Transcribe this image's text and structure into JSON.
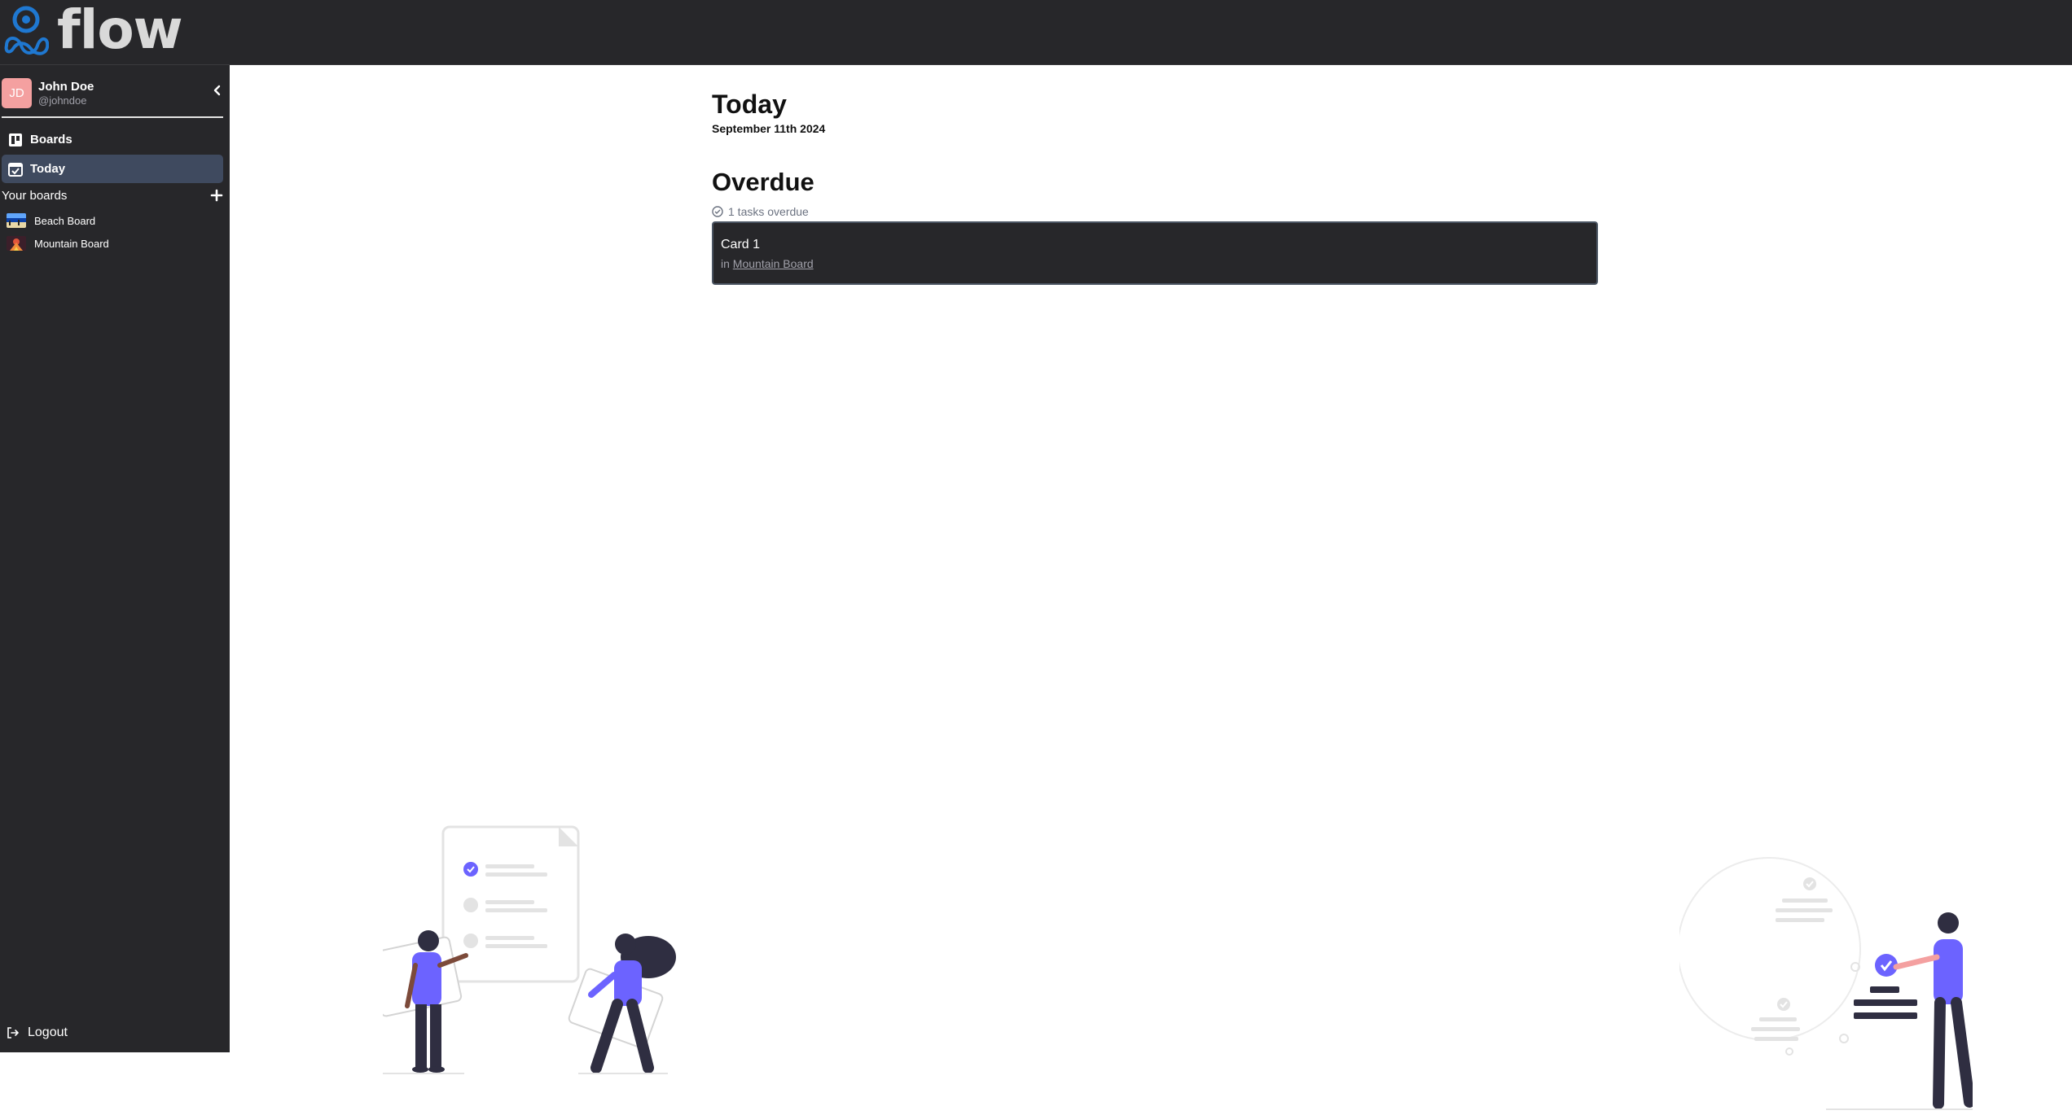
{
  "app": {
    "logo_text": "flow",
    "brand_color": "#1f78d1"
  },
  "user": {
    "initials": "JD",
    "name": "John Doe",
    "handle": "@johndoe"
  },
  "nav": {
    "boards_label": "Boards",
    "today_label": "Today"
  },
  "sidebar": {
    "section_label": "Your boards",
    "boards": [
      {
        "name": "Beach Board",
        "thumb": "beach-thumbnail"
      },
      {
        "name": "Mountain Board",
        "thumb": "mountain-thumbnail"
      }
    ],
    "logout_label": "Logout"
  },
  "page": {
    "title": "Today",
    "date": "September 11th 2024",
    "overdue_title": "Overdue",
    "overdue_count": "1 tasks overdue"
  },
  "cards": [
    {
      "title": "Card 1",
      "prefix": "in",
      "board": "Mountain Board"
    }
  ],
  "colors": {
    "header_bg": "#27272a",
    "active_nav": "#3f4a5f",
    "accent": "#6c63ff",
    "avatar": "#f4a0a0"
  }
}
